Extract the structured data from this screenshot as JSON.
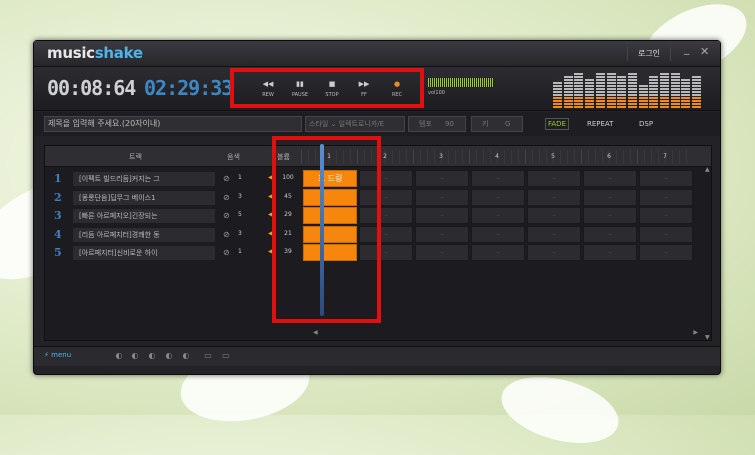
{
  "app": {
    "logo_a": "music",
    "logo_b": "shake",
    "login": "로그인",
    "minimize": "_",
    "close": "✕"
  },
  "timer": {
    "elapsed": "00:08:64",
    "total": "02:29:33"
  },
  "transport": [
    {
      "icon": "◀◀",
      "label": "REW",
      "name": "rew-icon"
    },
    {
      "icon": "▮▮",
      "label": "PAUSE",
      "name": "pause-icon"
    },
    {
      "icon": "■",
      "label": "STOP",
      "name": "stop-icon"
    },
    {
      "icon": "▶▶",
      "label": "FF",
      "name": "ff-icon"
    },
    {
      "icon": "●",
      "label": "REC",
      "name": "rec-icon"
    }
  ],
  "volume_label": "vol100",
  "toolbar": {
    "title_placeholder": "제목을 입력해 주세요.(20자이내)",
    "style_label": "스타일",
    "style_value": "일렉트로니카/E",
    "tempo_label": "템포",
    "tempo_value": "90",
    "key_label": "키",
    "key_value": "G",
    "fade": "FADE",
    "repeat": "REPEAT",
    "dsp": "DSP"
  },
  "table": {
    "col_track": "트랙",
    "col_sound": "음색",
    "col_vol": "볼륨",
    "ruler": [
      "1",
      "2",
      "3",
      "4",
      "5",
      "6",
      "7"
    ],
    "tracks": [
      {
        "num": "1",
        "name": "[이펙트 빌드리듬]커지는 그",
        "sound": "1",
        "vol": "100"
      },
      {
        "num": "2",
        "name": "[몽롱단음]딥무그 베이스1",
        "sound": "3",
        "vol": "45"
      },
      {
        "num": "3",
        "name": "[빠른 아르페지오]긴장되는",
        "sound": "5",
        "vol": "29"
      },
      {
        "num": "4",
        "name": "[리듬 아르페지터]경쾌한 동",
        "sound": "3",
        "vol": "21"
      },
      {
        "num": "5",
        "name": "[아르페지터]신비로운 하이",
        "sound": "1",
        "vol": "39"
      }
    ],
    "block_label": "포 드링",
    "empty_cell": "–"
  },
  "bottom": {
    "menu": "⚡ menu"
  },
  "colors": {
    "accent_orange": "#f7860c",
    "accent_blue": "#3c87c4",
    "accent_green": "#9acb2e",
    "highlight_red": "#e01010"
  }
}
